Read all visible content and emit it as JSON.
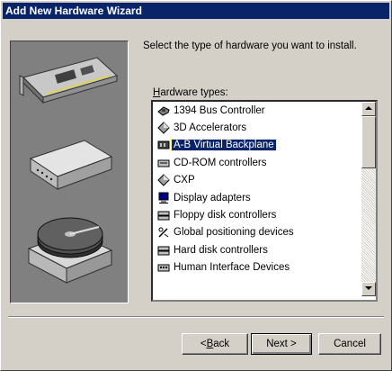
{
  "window": {
    "title": "Add New Hardware Wizard"
  },
  "main": {
    "instruction": "Select the type of hardware you want to install.",
    "list_label": "Hardware types:",
    "hardware_types": [
      {
        "label": "1394 Bus Controller",
        "icon": "bus-controller-icon"
      },
      {
        "label": "3D Accelerators",
        "icon": "diamond-icon"
      },
      {
        "label": "A-B Virtual Backplane",
        "icon": "backplane-icon",
        "selected": true
      },
      {
        "label": "CD-ROM controllers",
        "icon": "cdrom-icon"
      },
      {
        "label": "CXP",
        "icon": "diamond-icon"
      },
      {
        "label": "Display adapters",
        "icon": "monitor-icon"
      },
      {
        "label": "Floppy disk controllers",
        "icon": "disk-controller-icon"
      },
      {
        "label": "Global positioning devices",
        "icon": "gps-icon"
      },
      {
        "label": "Hard disk controllers",
        "icon": "disk-controller-icon"
      },
      {
        "label": "Human Interface Devices",
        "icon": "hid-icon"
      }
    ],
    "selected_color": "#0a246a"
  },
  "footer": {
    "back_label": "< Back",
    "next_label": "Next >",
    "cancel_label": "Cancel"
  }
}
